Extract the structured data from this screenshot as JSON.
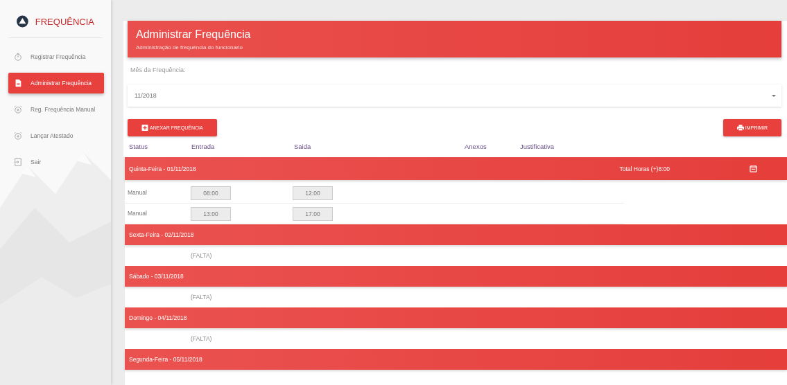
{
  "sidebar": {
    "title": "FREQUÊNCIA",
    "items": [
      {
        "label": "Registrar Frequência",
        "kind": "timer",
        "selected": false
      },
      {
        "label": "Administrar Frequência",
        "kind": "document",
        "selected": true
      },
      {
        "label": "Reg. Frequência Manual",
        "kind": "alarm",
        "selected": false
      },
      {
        "label": "Lançar Atestado",
        "kind": "alarm",
        "selected": false
      },
      {
        "label": "Sair",
        "kind": "exit",
        "selected": false
      }
    ]
  },
  "header": {
    "title": "Administrar Frequência",
    "subtitle": "Administração de frequência do funcionario"
  },
  "month": {
    "label": "Mês da Frequência:",
    "value": "11/2018"
  },
  "buttons": {
    "attach": "ANEXAR FREQUÊNCIA",
    "print": "IMPRIMIR"
  },
  "columns": [
    "Status",
    "Entrada",
    "Saida",
    "Anexos",
    "Justificativa"
  ],
  "days": [
    {
      "title": "Quinta-Feira - 01/11/2018",
      "total": "Total Horas (+)8:00",
      "kind": "entries",
      "entries": [
        {
          "status": "Manual",
          "in": "08:00",
          "out": "12:00"
        },
        {
          "status": "Manual",
          "in": "13:00",
          "out": "17:00"
        }
      ]
    },
    {
      "title": "Sexta-Feira - 02/11/2018",
      "kind": "absent",
      "note": "(FALTA)"
    },
    {
      "title": "Sábado - 03/11/2018",
      "kind": "absent",
      "note": "(FALTA)"
    },
    {
      "title": "Domingo - 04/11/2018",
      "kind": "absent",
      "note": "(FALTA)"
    },
    {
      "title": "Segunda-Feira - 05/11/2018",
      "kind": "none"
    }
  ]
}
